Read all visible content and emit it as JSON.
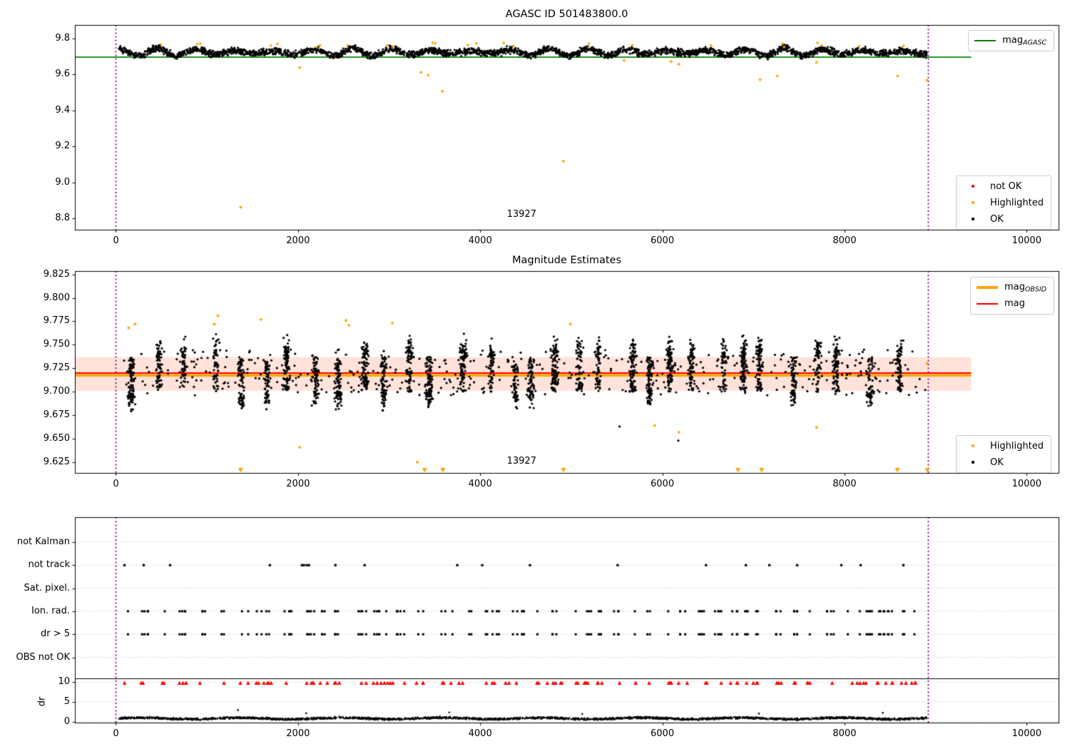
{
  "figure": {
    "bg": "#ffffff"
  },
  "colors": {
    "ok": "#000000",
    "not_ok": "#ff0000",
    "highlighted": "#ffa500",
    "mag_agasc_line": "#008000",
    "mag_line": "#ff0000",
    "mag_obsid_line": "#ffa500",
    "vline": "#800080",
    "band": "rgba(255,80,30,0.16)",
    "grid": "#b5b5b5"
  },
  "chart_data": {
    "top": {
      "type": "scatter",
      "title": "AGASC ID 501483800.0",
      "xlim": [
        -450,
        10350
      ],
      "ylim": [
        8.737,
        9.875
      ],
      "xticks": [
        "0",
        "2000",
        "4000",
        "6000",
        "8000",
        "10000"
      ],
      "xtick_values": [
        0,
        2000,
        4000,
        6000,
        8000,
        10000
      ],
      "yticks": [
        "9.8",
        "9.6",
        "9.4",
        "9.2",
        "9.0",
        "8.8"
      ],
      "ytick_values": [
        9.8,
        9.6,
        9.4,
        9.2,
        9.0,
        8.8
      ],
      "count_annotation": "13927",
      "annotation_x": 4455,
      "mag_line": {
        "value": 9.696,
        "x_start": -450,
        "x_end": 9390
      },
      "vlines": [
        0,
        8920
      ],
      "legend_line": {
        "main": "mag",
        "sub": "AGASC"
      },
      "legend_markers": [
        {
          "label": "not OK",
          "color": "#ff0000"
        },
        {
          "label": "Highlighted",
          "color": "#ffa500"
        },
        {
          "label": "OK",
          "color": "#000000"
        }
      ],
      "ok_series": {
        "seed": 11,
        "n": 3000,
        "x_range": [
          25,
          8905
        ],
        "y_base": 9.724,
        "wave_period": 430,
        "wave_amp": 0.014,
        "wave_amp_mod": 0.008,
        "wave_mod_period": 2300,
        "noise": 0.0095,
        "spread": 0.028,
        "y_clamp": [
          9.671,
          9.787
        ]
      },
      "highlighted_sprinkle": {
        "seed": 21,
        "n": 26,
        "y_min": 9.752,
        "y_max": 9.778
      },
      "highlighted_outliers": [
        [
          1370,
          8.862
        ],
        [
          2018,
          9.638
        ],
        [
          3350,
          9.612
        ],
        [
          3430,
          9.597
        ],
        [
          3584,
          9.507
        ],
        [
          4914,
          9.118
        ],
        [
          5580,
          9.678
        ],
        [
          6095,
          9.672
        ],
        [
          6181,
          9.657
        ],
        [
          7074,
          9.571
        ],
        [
          7262,
          9.591
        ],
        [
          7692,
          9.667
        ],
        [
          8583,
          9.591
        ],
        [
          8905,
          9.568
        ]
      ]
    },
    "middle": {
      "type": "scatter",
      "title": "Magnitude Estimates",
      "xlim": [
        -450,
        10350
      ],
      "ylim": [
        9.6136,
        9.8285
      ],
      "xticks": [
        "0",
        "2000",
        "4000",
        "6000",
        "8000",
        "10000"
      ],
      "xtick_values": [
        0,
        2000,
        4000,
        6000,
        8000,
        10000
      ],
      "yticks": [
        "9.825",
        "9.800",
        "9.775",
        "9.750",
        "9.725",
        "9.700",
        "9.675",
        "9.650",
        "9.625"
      ],
      "ytick_values": [
        9.825,
        9.8,
        9.775,
        9.75,
        9.725,
        9.7,
        9.675,
        9.65,
        9.625
      ],
      "count_annotation": "13927",
      "annotation_x": 4455,
      "mag_line": {
        "value": 9.72,
        "x_start": -450,
        "x_end": 9390
      },
      "obsid_line": {
        "value": 9.7175,
        "x_start": -450,
        "x_end": 9390
      },
      "band": {
        "y_min": 9.701,
        "y_max": 9.737
      },
      "vlines": [
        0,
        8920
      ],
      "legend_lines": [
        {
          "main": "mag",
          "sub": "OBSID",
          "color": "#ffa500",
          "thick": true
        },
        {
          "main": "mag",
          "sub": "",
          "color": "#ff0000",
          "thick": false
        }
      ],
      "legend_markers": [
        {
          "label": "Highlighted",
          "color": "#ffa500"
        },
        {
          "label": "OK",
          "color": "#000000"
        }
      ],
      "ok_clusters": {
        "seed": 31,
        "x_range": [
          90,
          8905
        ],
        "step_min": 170,
        "step_rand": 230,
        "pts_min": 55,
        "pts_rand": 55,
        "x_spread": 36,
        "band_lo": 9.7,
        "band_hi": 9.737,
        "plume_up_max": 9.778,
        "plume_dn_min": 9.664,
        "between_n": 420
      },
      "ok_low_points": [
        [
          5530,
          9.663
        ],
        [
          6175,
          9.648
        ]
      ],
      "highlighted_points": [
        [
          140,
          9.768
        ],
        [
          210,
          9.772
        ],
        [
          1080,
          9.772
        ],
        [
          1120,
          9.781
        ],
        [
          1590,
          9.777
        ],
        [
          2018,
          9.641
        ],
        [
          2527,
          9.776
        ],
        [
          2559,
          9.771
        ],
        [
          3036,
          9.773
        ],
        [
          3310,
          9.625
        ],
        [
          4990,
          9.772
        ],
        [
          5916,
          9.664
        ],
        [
          6181,
          9.657
        ],
        [
          7692,
          9.662
        ],
        [
          8905,
          9.73
        ]
      ],
      "clipped_triangles_x": [
        1370,
        3390,
        3590,
        4914,
        6830,
        7090,
        8580,
        8910
      ]
    },
    "bottom": {
      "type": "flags",
      "xlim": [
        -450,
        10350
      ],
      "xticks": [
        "0",
        "2000",
        "4000",
        "6000",
        "8000",
        "10000"
      ],
      "xtick_values": [
        0,
        2000,
        4000,
        6000,
        8000,
        10000
      ],
      "flag_rows": [
        {
          "label": "not Kalman",
          "points": []
        },
        {
          "label": "not track",
          "points": [
            94,
            305,
            595,
            1690,
            2042,
            2065,
            2096,
            2120,
            2410,
            2731,
            3748,
            4022,
            4546,
            5509,
            6479,
            6917,
            7175,
            7480,
            7965,
            8177,
            8646
          ]
        },
        {
          "label": "Sat. pixel.",
          "points": []
        },
        {
          "label": "Ion. rad.",
          "use_clusters": true
        },
        {
          "label": "dr > 5",
          "use_clusters": true
        },
        {
          "label": "OBS not OK",
          "points": []
        }
      ],
      "cluster_spec": {
        "seed": 41,
        "x_range": [
          40,
          8900
        ],
        "step_min": 80,
        "step_rand": 200,
        "pts_min": 1,
        "pts_rand": 4,
        "spread": 45
      },
      "dr_label": "dr",
      "dr_ticks": [
        "10",
        "5",
        "0"
      ],
      "dr_tick_values": [
        10,
        5,
        0
      ],
      "vlines": [
        0,
        8920
      ],
      "red_series": {
        "seed": 51,
        "level": 10,
        "pts_min": 1,
        "pts_rand": 4,
        "spread": 55
      },
      "dr_ok_series": {
        "seed": 61,
        "n": 2600,
        "x_range": [
          30,
          8905
        ],
        "y_base": 0.55,
        "wave_amp": 0.18,
        "wave_period": 1100,
        "noise": 0.45,
        "y_clamp": [
          0.05,
          2.2
        ]
      },
      "dr_spikes": [
        [
          1340,
          2.9
        ],
        [
          2090,
          2.1
        ],
        [
          3660,
          2.3
        ],
        [
          5120,
          1.9
        ],
        [
          7060,
          2.0
        ],
        [
          8420,
          2.2
        ]
      ],
      "separator_level": 10.8
    }
  }
}
